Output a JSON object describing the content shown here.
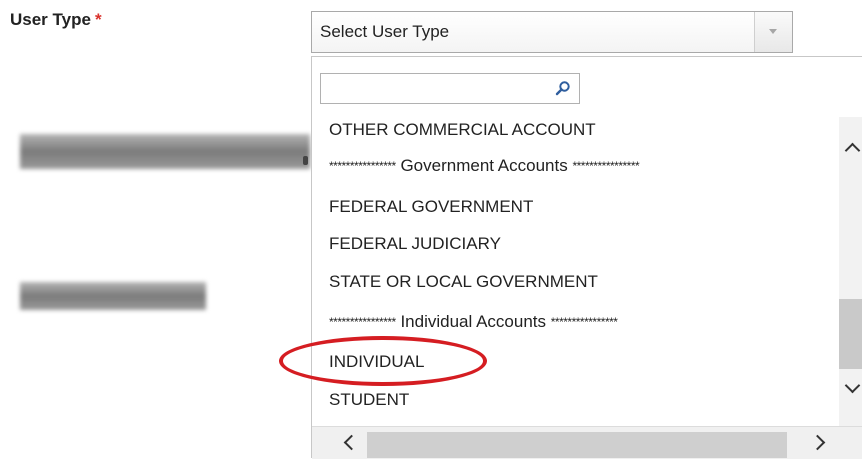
{
  "field": {
    "label": "User Type",
    "required_marker": "*"
  },
  "select": {
    "value": "Select User Type",
    "arrow_icon": "triangle-down-icon"
  },
  "dropdown": {
    "search": {
      "value": "",
      "placeholder": "",
      "icon": "magnifier-icon"
    },
    "options": [
      {
        "label": "OTHER COMMERCIAL ACCOUNT"
      },
      {
        "prefix": "****************",
        "label": "Government Accounts",
        "suffix": "****************"
      },
      {
        "label": "FEDERAL GOVERNMENT"
      },
      {
        "label": "FEDERAL JUDICIARY"
      },
      {
        "label": "STATE OR LOCAL GOVERNMENT"
      },
      {
        "prefix": "****************",
        "label": "Individual Accounts",
        "suffix": "****************"
      },
      {
        "label": "INDIVIDUAL"
      },
      {
        "label": "STUDENT"
      }
    ],
    "highlighted_option": "INDIVIDUAL"
  },
  "scrollbars": {
    "vertical": {
      "up_icon": "chevron-up-icon",
      "down_icon": "chevron-down-icon"
    },
    "horizontal": {
      "left_icon": "chevron-left-icon",
      "right_icon": "chevron-right-icon"
    }
  },
  "colors": {
    "required_star": "#d9312b",
    "highlight_ellipse": "#d51d22",
    "text": "#222222"
  }
}
